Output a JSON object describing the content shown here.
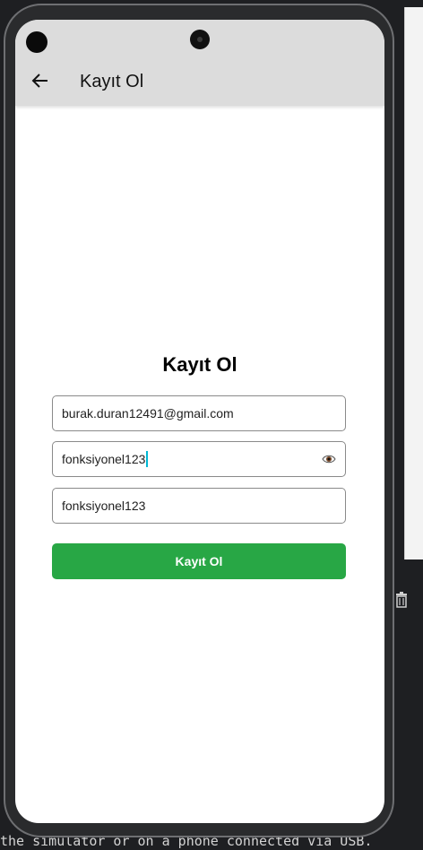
{
  "terminal": {
    "text": "the simulator or on a phone connected via USB."
  },
  "ide": {
    "trash_icon": "trash-icon"
  },
  "appbar": {
    "title": "Kayıt Ol",
    "back_icon": "arrow-left-icon"
  },
  "form": {
    "title": "Kayıt Ol",
    "email": {
      "value": "burak.duran12491@gmail.com"
    },
    "password": {
      "value": "fonksiyonel123",
      "toggle_icon": "eye-icon"
    },
    "confirm_password": {
      "value": "fonksiyonel123"
    },
    "submit_label": "Kayıt Ol"
  },
  "colors": {
    "appbar_bg": "#dcdcdc",
    "button_bg": "#28a745",
    "caret": "#00b8d4"
  }
}
